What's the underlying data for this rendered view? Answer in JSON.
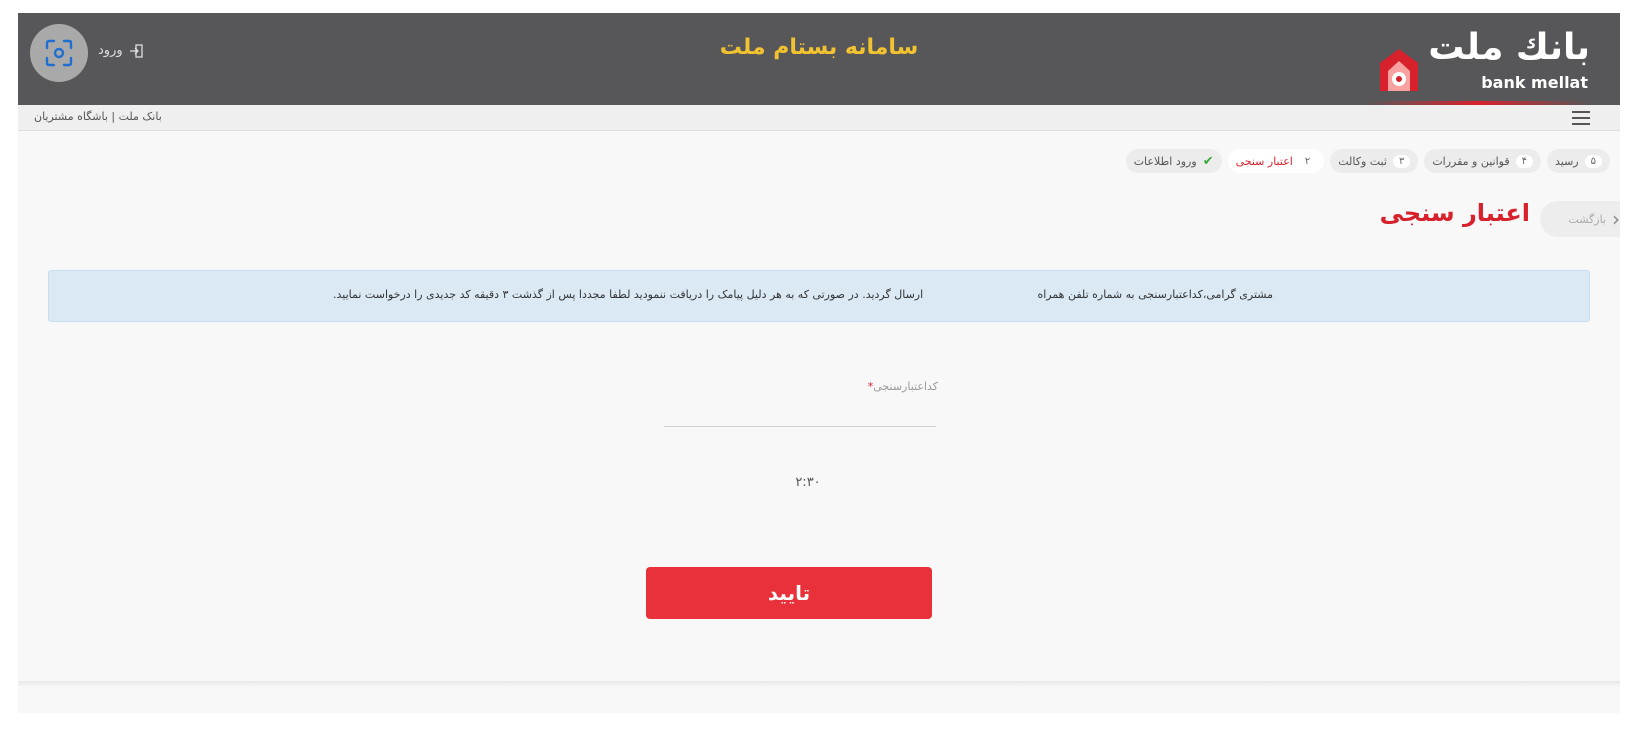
{
  "header": {
    "title": "سامانه بستام ملت",
    "login_label": "ورود",
    "logo_fa": "بانك ملت",
    "logo_en": "bank mellat"
  },
  "subbar": {
    "breadcrumb": "بانک ملت | باشگاه مشتریان"
  },
  "steps": [
    {
      "num": "",
      "label": "ورود اطلاعات",
      "state": "done"
    },
    {
      "num": "۲",
      "label": "اعتبار سنجی",
      "state": "active"
    },
    {
      "num": "۳",
      "label": "ثبت وکالت",
      "state": "pending"
    },
    {
      "num": "۴",
      "label": "قوانین و مقررات",
      "state": "pending"
    },
    {
      "num": "۵",
      "label": "رسید",
      "state": "pending"
    }
  ],
  "page": {
    "title": "اعتبار سنجی",
    "back_label": "بازگشت"
  },
  "info": {
    "text_a": "مشتری گرامی،کداعتبارسنجی به شماره تلفن همراه",
    "text_b": "ارسال گردید. در صورتی که به هر دلیل پیامک را دریافت ننمودید لطفا مجددا پس از گذشت ۳ دقیقه کد جدیدی را درخواست نمایید."
  },
  "form": {
    "code_label": "کداعتبارسنجی",
    "required_mark": "*",
    "code_value": "",
    "timer": "۲:۳۰",
    "confirm_label": "تایید"
  },
  "colors": {
    "header_bg": "#575759",
    "title_yellow": "#f2c230",
    "brand_red": "#d7222d",
    "button_red": "#e8313a",
    "info_bg": "#dbe9f5"
  },
  "icons": {
    "scan": "scan-icon",
    "login": "login-icon",
    "menu": "hamburger-icon",
    "back": "chevron-left-icon",
    "check": "check-icon"
  }
}
